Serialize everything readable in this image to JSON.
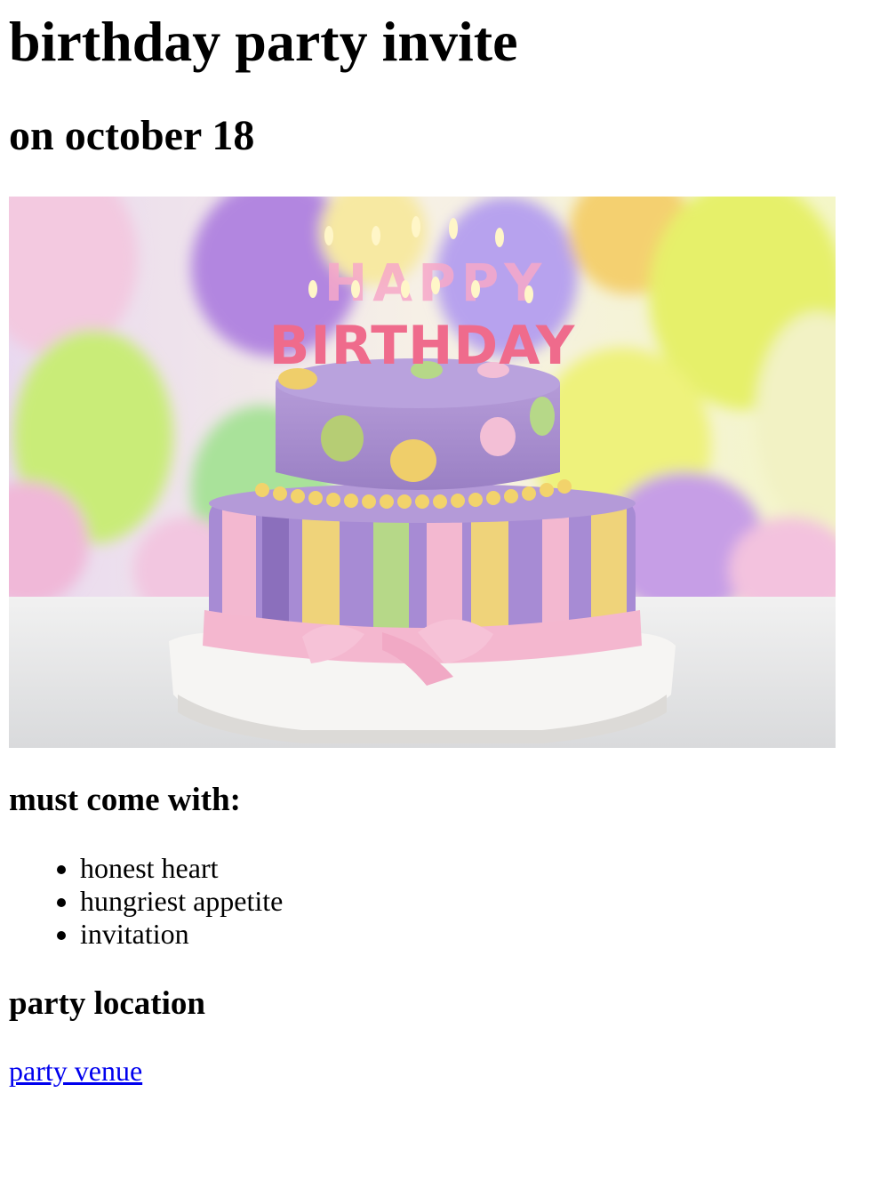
{
  "heading": {
    "title": "birthday party invite",
    "date": "on october 18"
  },
  "image": {
    "alt": "birthday cake",
    "candle_letters_top": "HAPPY",
    "candle_letters_bottom": "BIRTHDAY",
    "colors": {
      "purple": "#a88ad0",
      "pink": "#f3b8d0",
      "yellow": "#efd37a",
      "green": "#b6d888",
      "balloon_yellow": "#eef2a0"
    }
  },
  "bring": {
    "heading": "must come with:",
    "items": [
      "honest heart",
      "hungriest appetite",
      "invitation"
    ]
  },
  "location": {
    "heading": "party location",
    "link_text": "party venue"
  }
}
